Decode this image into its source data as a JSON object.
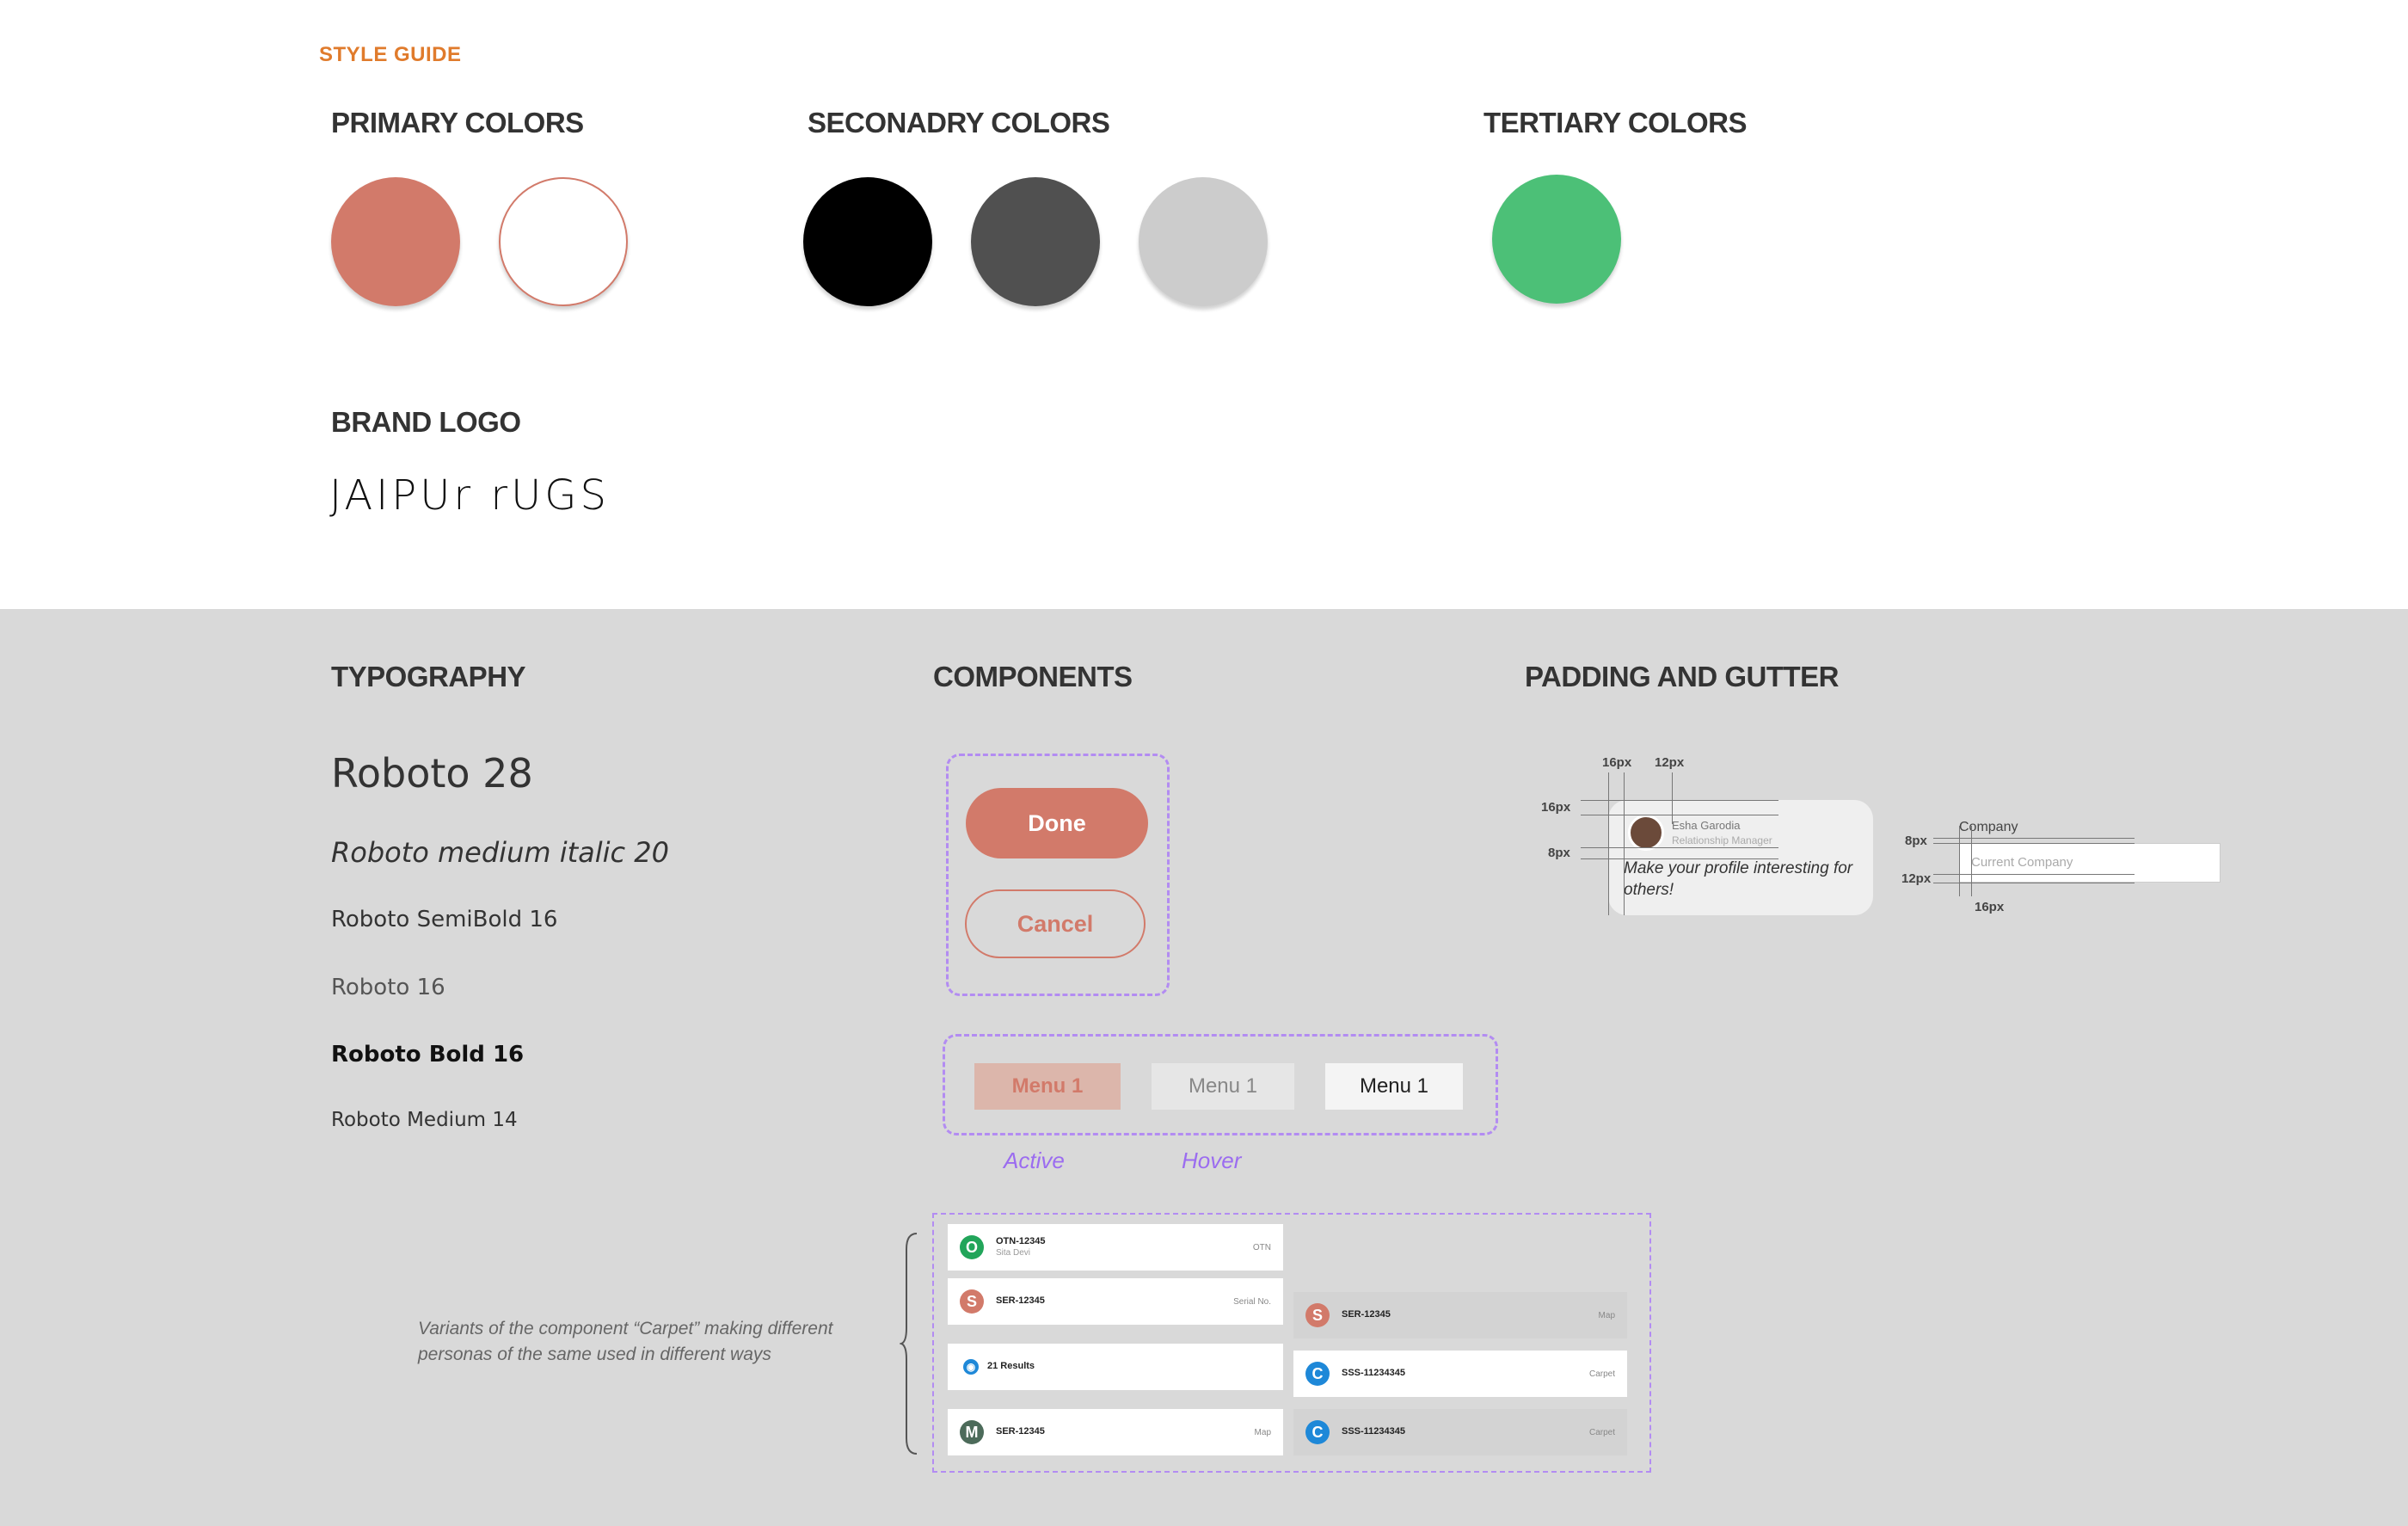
{
  "header": {
    "eyebrow": "STYLE GUIDE"
  },
  "colors": {
    "primary_title": "PRIMARY COLORS",
    "secondary_title": "SECONADRY COLORS",
    "tertiary_title": "TERTIARY COLORS",
    "primary": [
      "#d27a6a",
      "#ffffff"
    ],
    "primary_outline": "#d27a6a",
    "secondary": [
      "#000000",
      "#505050",
      "#cccccc"
    ],
    "tertiary": [
      "#4cc077"
    ]
  },
  "brand": {
    "title": "BRAND LOGO",
    "logo_text": "JAIPUr rUGS"
  },
  "typography": {
    "title": "TYPOGRAPHY",
    "samples": [
      "Roboto 28",
      "Roboto medium italic 20",
      "Roboto SemiBold 16",
      "Roboto 16",
      "Roboto Bold 16",
      "Roboto Medium 14"
    ]
  },
  "components": {
    "title": "COMPONENTS",
    "done_label": "Done",
    "cancel_label": "Cancel",
    "menus": [
      "Menu 1",
      "Menu 1",
      "Menu 1"
    ],
    "active_label": "Active",
    "hover_label": "Hover",
    "carpets_left": [
      {
        "icon": "O",
        "color": "#22a55a",
        "id": "OTN-12345",
        "sub": "Sita Devi",
        "tag": "OTN"
      },
      {
        "icon": "S",
        "color": "#d27a6a",
        "id": "SER-12345",
        "sub": "",
        "tag": "Serial No."
      },
      {
        "icon": "◉",
        "color": "#1e88d8",
        "id": "21 Results",
        "sub": "",
        "tag": ""
      },
      {
        "icon": "M",
        "color": "#4c6b5a",
        "id": "SER-12345",
        "sub": "",
        "tag": "Map"
      }
    ],
    "carpets_right": [
      {
        "icon": "S",
        "color": "#d27a6a",
        "id": "SER-12345",
        "tag": "Map"
      },
      {
        "icon": "C",
        "color": "#1e88d8",
        "id": "SSS-11234345",
        "tag": "Carpet"
      },
      {
        "icon": "C",
        "color": "#1e88d8",
        "id": "SSS-11234345",
        "tag": "Carpet"
      }
    ],
    "note": "Variants of the component “Carpet” making different personas of the same used in different ways"
  },
  "padding": {
    "title": "PADDING AND GUTTER",
    "labels": {
      "a": "16px",
      "b": "12px",
      "c": "16px",
      "d": "8px",
      "e": "8px",
      "f": "12px",
      "g": "16px"
    },
    "card_name": "Esha Garodia",
    "card_role": "Relationship Manager",
    "card_text": "Make your profile interesting for others!",
    "field_label": "Company",
    "field_placeholder": "Current Company"
  }
}
